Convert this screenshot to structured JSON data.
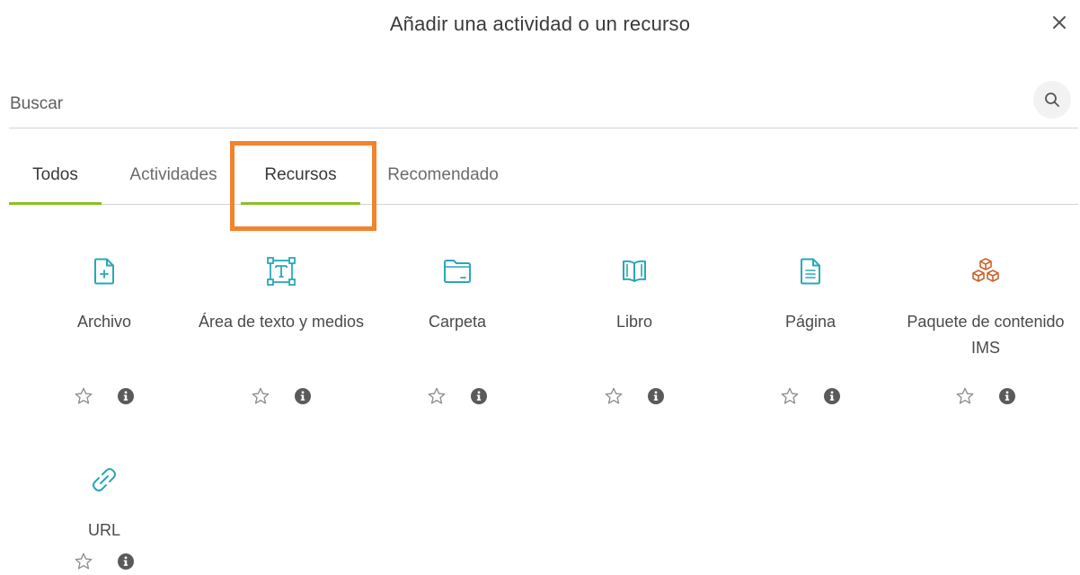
{
  "dialog": {
    "title": "Añadir una actividad o un recurso",
    "close_icon": "close-icon"
  },
  "search": {
    "placeholder": "Buscar",
    "value": "",
    "icon": "search-icon"
  },
  "tabs": [
    {
      "label": "Todos"
    },
    {
      "label": "Actividades"
    },
    {
      "label": "Recursos"
    },
    {
      "label": "Recomendado"
    }
  ],
  "active_tab": "Recursos",
  "colors": {
    "accent_underline": "#8cbf26",
    "highlight_box": "#f2832f",
    "resource_icon": "#2aa7b6",
    "ims_icon": "#c8642c"
  },
  "items": [
    {
      "label": "Archivo",
      "icon": "file-add-icon"
    },
    {
      "label": "Área de texto y medios",
      "icon": "text-area-icon"
    },
    {
      "label": "Carpeta",
      "icon": "folder-icon"
    },
    {
      "label": "Libro",
      "icon": "book-icon"
    },
    {
      "label": "Página",
      "icon": "page-icon"
    },
    {
      "label": "Paquete de contenido IMS",
      "icon": "ims-package-icon"
    },
    {
      "label": "URL",
      "icon": "link-icon"
    }
  ]
}
